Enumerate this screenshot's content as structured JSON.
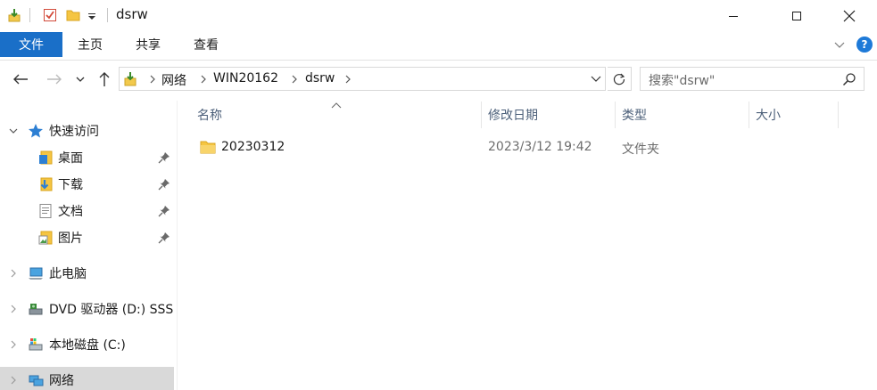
{
  "window": {
    "title": "dsrw",
    "minimize_icon": "minimize-icon",
    "maximize_icon": "maximize-icon",
    "close_icon": "close-icon"
  },
  "quick_access_toolbar": {
    "icons": [
      "properties-icon",
      "checkbox-icon",
      "folder-icon",
      "customize-dropdown-icon"
    ]
  },
  "ribbon": {
    "file_tab": "文件",
    "tabs": [
      "主页",
      "共享",
      "查看"
    ],
    "accent_color": "#1a6fc8",
    "help_label": "?"
  },
  "address": {
    "breadcrumb": [
      "网络",
      "WIN20162",
      "dsrw"
    ],
    "search_placeholder": "搜索\"dsrw\""
  },
  "nav_pane": {
    "quick_access": {
      "label": "快速访问",
      "items": [
        {
          "label": "桌面",
          "icon": "desktop-icon",
          "pinned": true
        },
        {
          "label": "下载",
          "icon": "downloads-icon",
          "pinned": true
        },
        {
          "label": "文档",
          "icon": "documents-icon",
          "pinned": true
        },
        {
          "label": "图片",
          "icon": "pictures-icon",
          "pinned": true
        }
      ]
    },
    "roots": [
      {
        "label": "此电脑",
        "icon": "computer-icon"
      },
      {
        "label": "DVD 驱动器 (D:) SSS",
        "icon": "dvd-drive-icon"
      },
      {
        "label": "本地磁盘 (C:)",
        "icon": "local-disk-icon"
      },
      {
        "label": "网络",
        "icon": "network-icon",
        "selected": true
      }
    ]
  },
  "file_list": {
    "columns": [
      "名称",
      "修改日期",
      "类型",
      "大小"
    ],
    "rows": [
      {
        "name": "20230312",
        "modified": "2023/3/12 19:42",
        "type": "文件夹",
        "size": ""
      }
    ]
  }
}
